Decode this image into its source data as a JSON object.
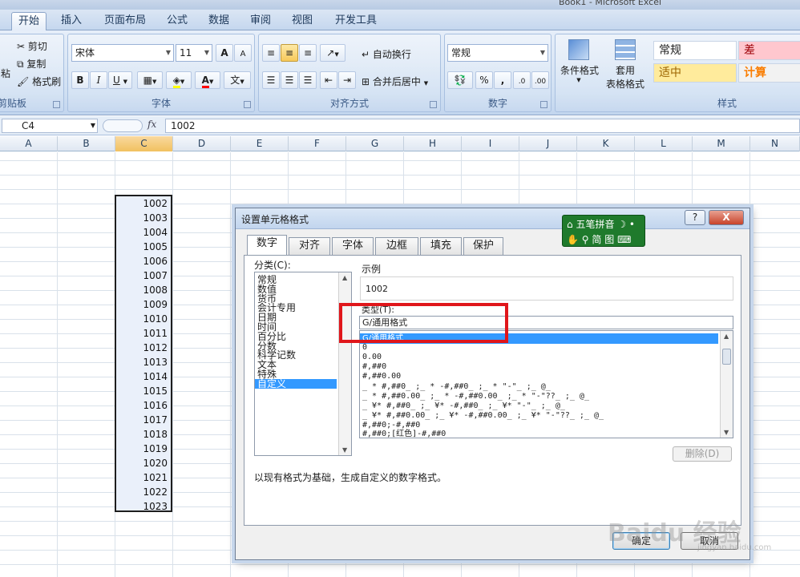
{
  "window": {
    "title": "Book1 - Microsoft Excel"
  },
  "ribbon_tabs": [
    "开始",
    "插入",
    "页面布局",
    "公式",
    "数据",
    "审阅",
    "视图",
    "开发工具"
  ],
  "clipboard": {
    "cut": "剪切",
    "copy": "复制",
    "format_painter": "格式刷",
    "paste_fragment": "粘",
    "group_label": "剪贴板"
  },
  "font": {
    "name": "宋体",
    "size": "11",
    "group_label": "字体",
    "bold": "B",
    "italic": "I",
    "underline": "U",
    "font_color": "A",
    "grow": "A",
    "shrink": "A",
    "phonetic": "文"
  },
  "alignment": {
    "wrap_text": "自动换行",
    "merge_center": "合并后居中",
    "group_label": "对齐方式"
  },
  "number": {
    "format": "常规",
    "percent": "%",
    "comma": ",",
    "group_label": "数字"
  },
  "styles": {
    "conditional_formatting": "条件格式",
    "format_as_table_line1": "套用",
    "format_as_table_line2": "表格格式",
    "cells": [
      {
        "label": "常规",
        "color": "#1e1e1e",
        "bg": "#ffffff"
      },
      {
        "label": "差",
        "color": "#9c0006",
        "bg": "#ffc7ce"
      },
      {
        "label": "适中",
        "color": "#9c6500",
        "bg": "#ffeb9c"
      },
      {
        "label": "计算",
        "color": "#fa7d00",
        "bg": "#f2f2f2"
      }
    ],
    "group_label": "样式"
  },
  "formula_bar": {
    "name_box": "C4",
    "fx": "fx",
    "value": "1002"
  },
  "columns": [
    "A",
    "B",
    "C",
    "D",
    "E",
    "F",
    "G",
    "H",
    "I",
    "J",
    "K",
    "L",
    "M",
    "N"
  ],
  "selected_column": "C",
  "cell_values": [
    "1002",
    "1003",
    "1004",
    "1005",
    "1006",
    "1007",
    "1008",
    "1009",
    "1010",
    "1011",
    "1012",
    "1013",
    "1014",
    "1015",
    "1016",
    "1017",
    "1018",
    "1019",
    "1020",
    "1021",
    "1022",
    "1023"
  ],
  "dialog": {
    "title": "设置单元格格式",
    "help": "?",
    "close": "X",
    "tabs": [
      "数字",
      "对齐",
      "字体",
      "边框",
      "填充",
      "保护"
    ],
    "category_label": "分类(C):",
    "categories": [
      "常规",
      "数值",
      "货币",
      "会计专用",
      "日期",
      "时间",
      "百分比",
      "分数",
      "科学记数",
      "文本",
      "特殊",
      "自定义"
    ],
    "selected_category": "自定义",
    "sample_label": "示例",
    "sample_value": "1002",
    "type_label": "类型(T):",
    "type_value": "G/通用格式",
    "formats": [
      "G/通用格式",
      "0",
      "0.00",
      "#,##0",
      "#,##0.00",
      "_ * #,##0_ ;_ * -#,##0_ ;_ * \"-\"_ ;_ @_",
      "_ * #,##0.00_ ;_ * -#,##0.00_ ;_ * \"-\"??_ ;_ @_",
      "_ ¥* #,##0_ ;_ ¥* -#,##0_ ;_ ¥* \"-\"_ ;_ @_",
      "_ ¥* #,##0.00_ ;_ ¥* -#,##0.00_ ;_ ¥* \"-\"??_ ;_ @_",
      "#,##0;-#,##0",
      "#,##0;[红色]-#,##0"
    ],
    "delete_button": "删除(D)",
    "description": "以现有格式为基础，生成自定义的数字格式。",
    "ok": "确定",
    "cancel": "取消"
  },
  "ime": {
    "name": "五笔拼音",
    "mode": "简",
    "extra": "图"
  },
  "watermark": {
    "text": "Baidu 经验",
    "sub": "jingyan.baidu.com"
  }
}
